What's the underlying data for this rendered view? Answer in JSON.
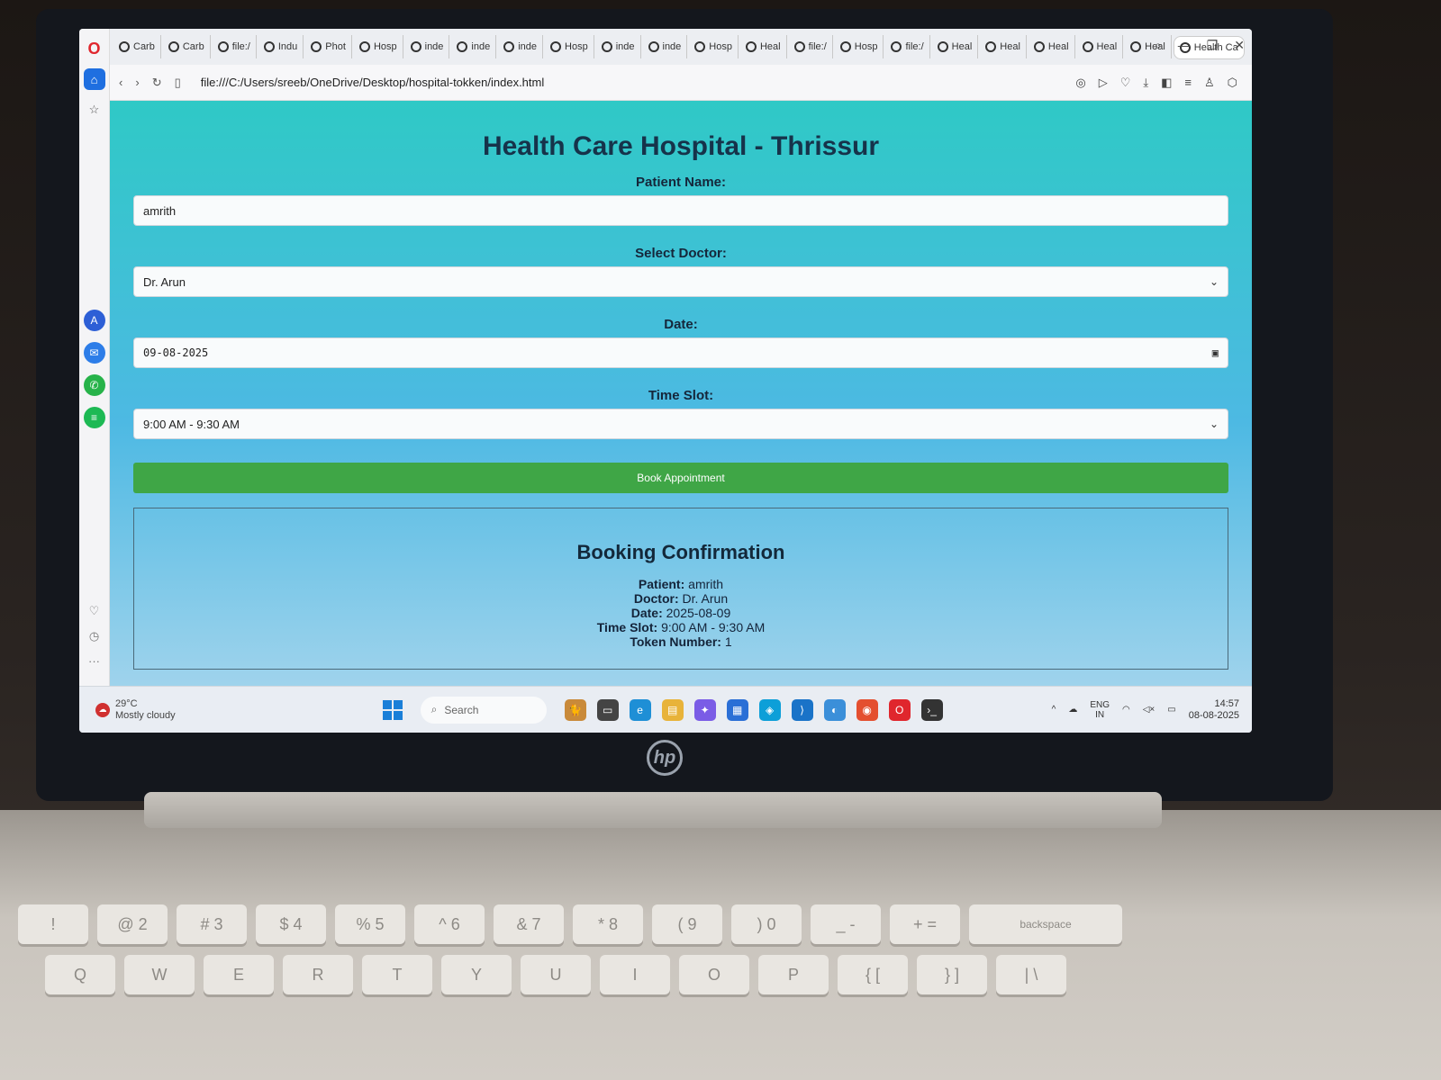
{
  "browser": {
    "tabs": [
      "Carb",
      "Carb",
      "file:/",
      "Indu",
      "Phot",
      "Hosp",
      "inde",
      "inde",
      "inde",
      "Hosp",
      "inde",
      "inde",
      "Hosp",
      "Heal",
      "file:/",
      "Hosp",
      "file:/",
      "Heal",
      "Heal",
      "Heal",
      "Heal",
      "Heal"
    ],
    "active_tab": "Health Ca",
    "url": "file:///C:/Users/sreeb/OneDrive/Desktop/hospital-tokken/index.html"
  },
  "page": {
    "title": "Health Care Hospital - Thrissur",
    "patient_label": "Patient Name:",
    "patient_value": "amrith",
    "doctor_label": "Select Doctor:",
    "doctor_value": "Dr. Arun",
    "date_label": "Date:",
    "date_value": "09-08-2025",
    "slot_label": "Time Slot:",
    "slot_value": "9:00 AM - 9:30 AM",
    "book_button": "Book Appointment"
  },
  "confirmation": {
    "heading": "Booking Confirmation",
    "patient_key": "Patient:",
    "patient": "amrith",
    "doctor_key": "Doctor:",
    "doctor": "Dr. Arun",
    "date_key": "Date:",
    "date": "2025-08-09",
    "slot_key": "Time Slot:",
    "slot": "9:00 AM - 9:30 AM",
    "token_key": "Token Number:",
    "token": "1"
  },
  "taskbar": {
    "weather_temp": "29°C",
    "weather_desc": "Mostly cloudy",
    "search_placeholder": "Search",
    "lang": "ENG",
    "region": "IN",
    "time": "14:57",
    "date": "08-08-2025"
  },
  "laptop": {
    "brand": "hp",
    "keys_row1": [
      "!",
      "@ 2",
      "# 3",
      "$ 4",
      "% 5",
      "^ 6",
      "& 7",
      "* 8",
      "( 9",
      ") 0",
      "_ -",
      "+ =",
      "backspace"
    ],
    "keys_row2": [
      "Q",
      "W",
      "E",
      "R",
      "T",
      "Y",
      "U",
      "I",
      "O",
      "P",
      "{ [",
      "} ]",
      "| \\"
    ]
  },
  "colors": {
    "page_gradient_top": "#2fc9c6",
    "page_gradient_bottom": "#9fd3ec",
    "book_button": "#3fa646",
    "title_text": "#16334a"
  }
}
